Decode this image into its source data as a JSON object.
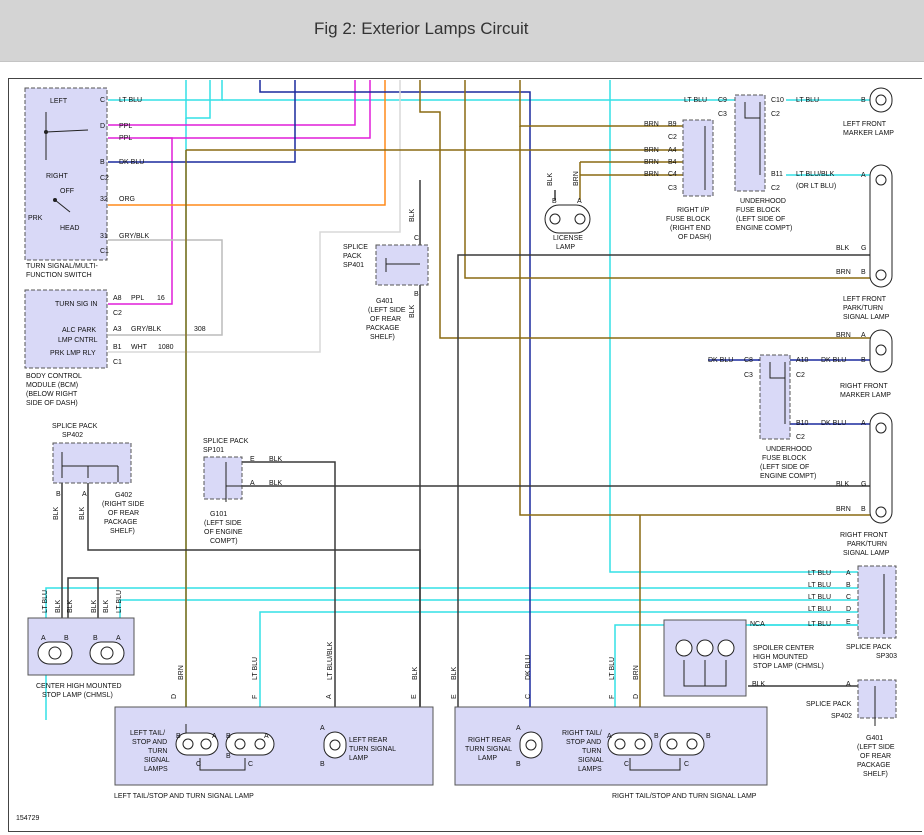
{
  "title": "Fig 2: Exterior Lamps Circuit",
  "figure_id": "154729",
  "colors": {
    "lt_blu": "#33e0e6",
    "ppl": "#e01fd8",
    "org": "#ff8a1a",
    "dk_blu": "#1a2a9e",
    "brn": "#8a6a12",
    "blk": "#3a3a3a",
    "gry": "#bcbcbc",
    "white": "#d8d8d8",
    "box_fill": "#d9d9f7"
  },
  "switch": {
    "left": "LEFT",
    "right": "RIGHT",
    "off": "OFF",
    "prk": "PRK",
    "head": "HEAD",
    "name": [
      "TURN SIGNAL/MULTI-",
      "FUNCTION SWITCH"
    ],
    "pins": [
      "C",
      "D",
      "B",
      "C2",
      "32",
      "31",
      "C1"
    ],
    "wires": [
      "LT BLU",
      "PPL",
      "PPL",
      "DK BLU",
      "ORG",
      "GRY/BLK"
    ]
  },
  "bcm": {
    "rows": [
      "TURN SIG IN",
      "ALC PARK",
      "LMP CNTRL",
      "PRK LMP RLY"
    ],
    "pins": [
      "A8",
      "C2",
      "A3",
      "B1",
      "C1"
    ],
    "wires": [
      "PPL",
      "16",
      "GRY/BLK",
      "308",
      "WHT",
      "1080"
    ],
    "name": [
      "BODY CONTROL",
      "MODULE (BCM)",
      "(BELOW RIGHT",
      "SIDE OF DASH)"
    ]
  },
  "sp401": {
    "name": [
      "SPLICE",
      "PACK",
      "SP401"
    ],
    "pins": [
      "C",
      "B"
    ],
    "wires": [
      "BLK",
      "BLK"
    ],
    "ground": [
      "G401",
      "(LEFT SIDE",
      "OF REAR",
      "PACKAGE",
      "SHELF)"
    ]
  },
  "license": {
    "pins": [
      "B",
      "A"
    ],
    "wires": [
      "BLK",
      "BRN"
    ],
    "name": [
      "LICENSE",
      "LAMP"
    ]
  },
  "ip_fuse": {
    "pins": [
      "B9",
      "C2",
      "A4",
      "B4",
      "C4",
      "C3"
    ],
    "wires": [
      "BRN",
      "BRN",
      "BRN",
      "BRN"
    ],
    "name": [
      "RIGHT I/P",
      "FUSE BLOCK",
      "(RIGHT END",
      "OF DASH)"
    ]
  },
  "uh_fuse_left": {
    "pins": [
      "C9",
      "C3",
      "C10",
      "C2",
      "B11",
      "C2"
    ],
    "wires": [
      "LT BLU",
      "LT BLU",
      "LT BLU/BLK",
      "(OR LT BLU)"
    ],
    "name": [
      "UNDERHOOD",
      "FUSE BLOCK",
      "(LEFT SIDE OF",
      "ENGINE COMPT)"
    ]
  },
  "uh_fuse_right": {
    "pins": [
      "C8",
      "C3",
      "A10",
      "C2",
      "B10",
      "C2"
    ],
    "wires": [
      "DK BLU",
      "DK BLU",
      "DK BLU"
    ],
    "name": [
      "UNDERHOOD",
      "FUSE BLOCK",
      "(LEFT SIDE OF",
      "ENGINE COMPT)"
    ]
  },
  "left_marker": {
    "pin": "B",
    "name": [
      "LEFT FRONT",
      "MARKER LAMP"
    ]
  },
  "left_park": {
    "pins": [
      "A",
      "G",
      "B"
    ],
    "wires": [
      "BLK",
      "BRN"
    ],
    "name": [
      "LEFT FRONT",
      "PARK/TURN",
      "SIGNAL LAMP"
    ]
  },
  "right_marker": {
    "pins": [
      "A",
      "B"
    ],
    "wires": [
      "BRN"
    ],
    "name": [
      "RIGHT FRONT",
      "MARKER LAMP"
    ]
  },
  "right_park": {
    "pins": [
      "A",
      "G",
      "B"
    ],
    "wires": [
      "BLK",
      "BRN"
    ],
    "name": [
      "RIGHT FRONT",
      "PARK/TURN",
      "SIGNAL LAMP"
    ]
  },
  "sp402_left": {
    "name": [
      "SPLICE PACK",
      "SP402"
    ],
    "pins": [
      "B",
      "A"
    ],
    "wires": [
      "BLK",
      "BLK"
    ],
    "ground": [
      "G402",
      "(RIGHT SIDE",
      "OF REAR",
      "PACKAGE",
      "SHELF)"
    ]
  },
  "sp101": {
    "name": [
      "SPLICE PACK",
      "SP101"
    ],
    "pins": [
      "E",
      "A"
    ],
    "wires": [
      "BLK",
      "BLK"
    ],
    "ground": [
      "G101",
      "(LEFT SIDE",
      "OF ENGINE",
      "COMPT)"
    ]
  },
  "chmsl": {
    "pins": [
      "A",
      "B",
      "B",
      "A"
    ],
    "wires": [
      "LT BLU",
      "BLK",
      "BLK",
      "BLK",
      "BLK",
      "LT BLU"
    ],
    "name": [
      "CENTER HIGH MOUNTED",
      "STOP LAMP (CHMSL)"
    ]
  },
  "spoiler": {
    "pins": [
      "NCA",
      "A"
    ],
    "wires": [
      "LT BLU",
      "BLK"
    ],
    "name": [
      "SPOILER CENTER",
      "HIGH MOUNTED",
      "STOP LAMP (CHMSL)"
    ]
  },
  "sp303": {
    "pins": [
      "A",
      "B",
      "C",
      "D",
      "E",
      "F"
    ],
    "wires": [
      "LT BLU",
      "LT BLU",
      "LT BLU",
      "LT BLU",
      "LT BLU",
      "LT BLU"
    ],
    "name": [
      "SPLICE PACK",
      "SP303"
    ]
  },
  "sp402_right": {
    "pin": "A",
    "wire": "BLK",
    "name": [
      "SPLICE PACK",
      "SP402"
    ]
  },
  "g401": {
    "name": [
      "G401",
      "(LEFT SIDE",
      "OF REAR",
      "PACKAGE",
      "SHELF)"
    ]
  },
  "left_rear": {
    "pins": [
      "D",
      "F",
      "A",
      "E"
    ],
    "wires": [
      "BRN",
      "LT BLU",
      "LT BLU/BLK",
      "BLK"
    ],
    "inner_pins": [
      "B",
      "A",
      "B",
      "A",
      "A",
      "C",
      "B",
      "C",
      "B"
    ],
    "tail_name": [
      "LEFT TAIL/",
      "STOP AND",
      "TURN",
      "SIGNAL",
      "LAMPS"
    ],
    "turn_name": [
      "LEFT REAR",
      "TURN SIGNAL",
      "LAMP"
    ],
    "title": "LEFT TAIL/STOP AND TURN SIGNAL LAMP"
  },
  "right_rear": {
    "pins": [
      "E",
      "C",
      "F",
      "D"
    ],
    "wires": [
      "BLK",
      "DK BLU",
      "LT BLU",
      "BRN"
    ],
    "inner_pins": [
      "A",
      "B",
      "A",
      "B",
      "A",
      "B",
      "C",
      "C",
      "B"
    ],
    "turn_name": [
      "RIGHT REAR",
      "TURN SIGNAL",
      "LAMP"
    ],
    "tail_name": [
      "RIGHT TAIL/",
      "STOP AND",
      "TURN",
      "SIGNAL",
      "LAMPS"
    ],
    "title": "RIGHT TAIL/STOP AND TURN SIGNAL LAMP"
  }
}
